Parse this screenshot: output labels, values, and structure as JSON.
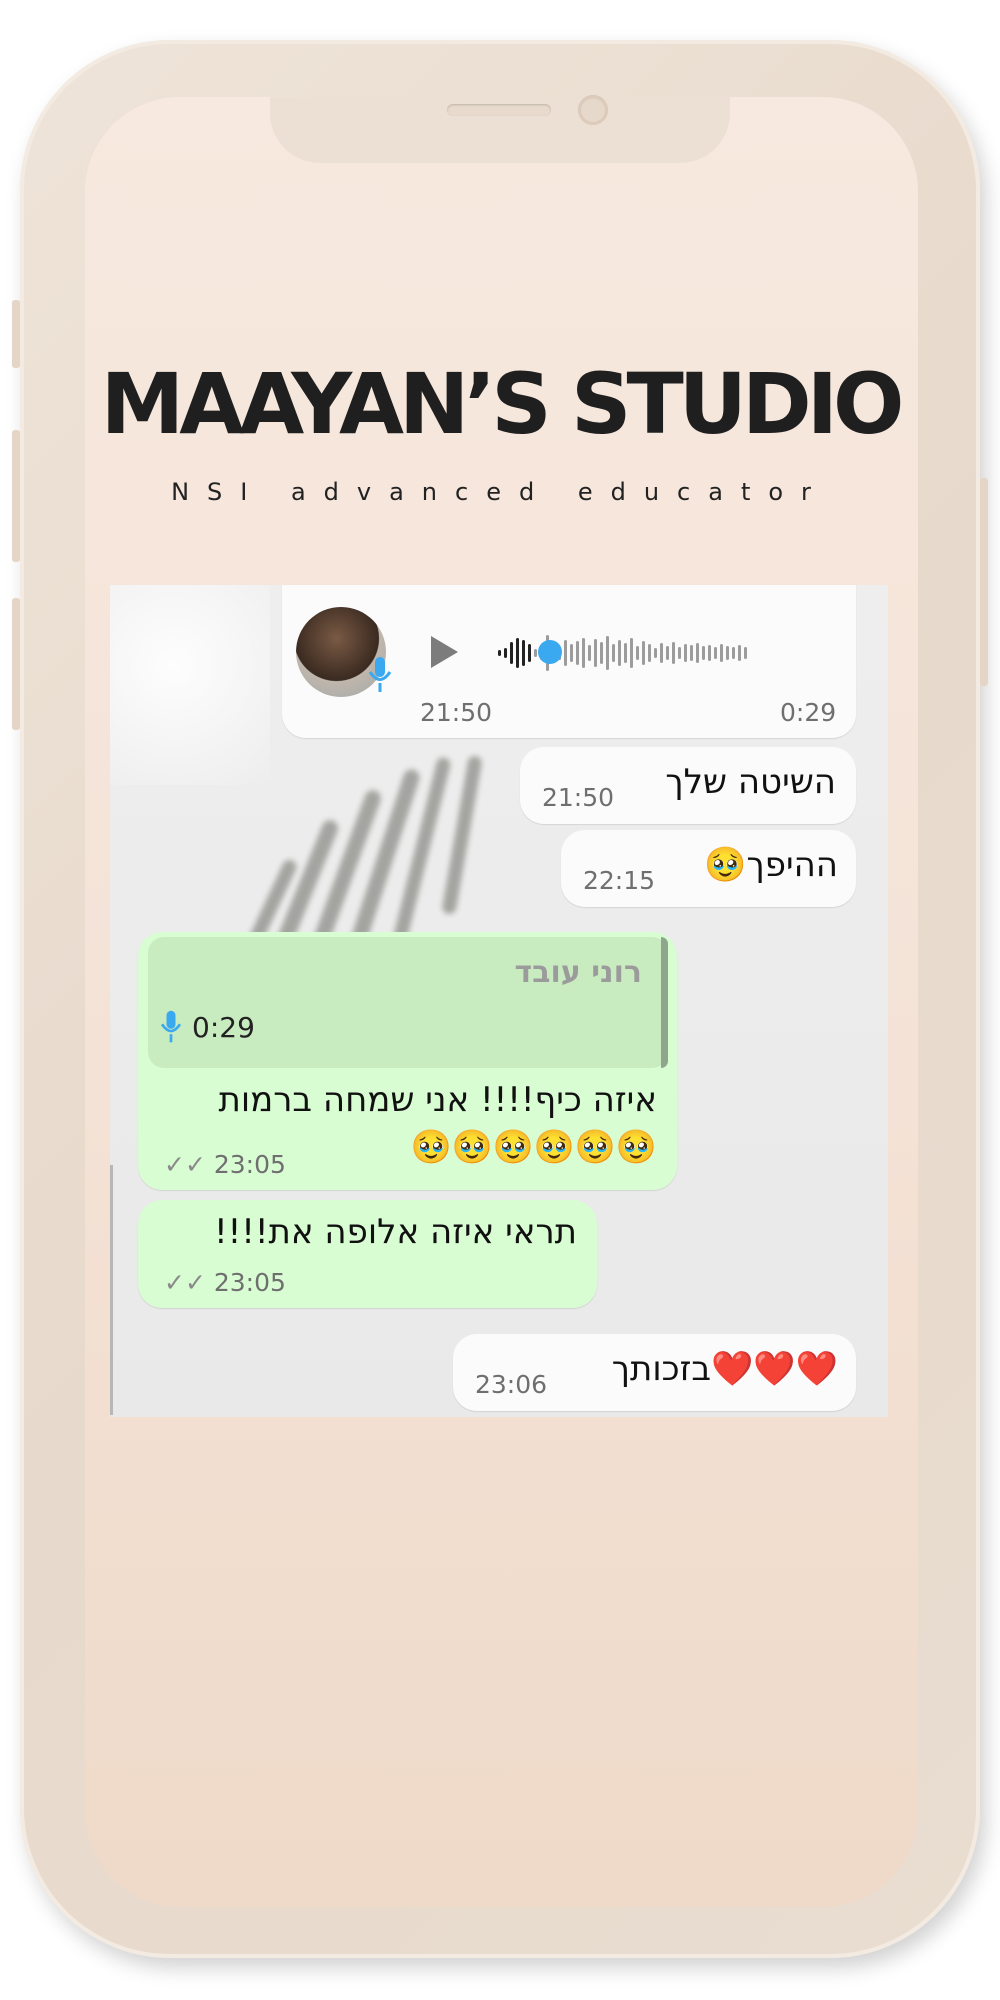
{
  "brand": {
    "title": "MAAYAN’S STUDIO",
    "subtitle": "NSI advanced educator"
  },
  "chat": {
    "voice_message": {
      "time": "21:50",
      "duration": "0:29",
      "progress": 0.05
    },
    "messages": [
      {
        "id": "m1",
        "side": "incoming",
        "text": "השיטה שלך",
        "time": "21:50"
      },
      {
        "id": "m2",
        "side": "incoming",
        "text": "ההיפך🥹",
        "time": "22:15"
      },
      {
        "id": "m3",
        "side": "outgoing",
        "quote_author": "רוני עובד",
        "quote_duration": "0:29",
        "text_line1": "איזה כיף!!!! אני שמחה ברמות",
        "text_line2": "🥹🥹🥹🥹🥹🥹",
        "time": "23:05"
      },
      {
        "id": "m4",
        "side": "outgoing",
        "text": "תראי איזה אלופה את!!!!",
        "time": "23:05"
      },
      {
        "id": "m5",
        "side": "incoming",
        "text": "❤️❤️❤️בזכותך",
        "time": "23:06"
      }
    ]
  },
  "icons": [
    "play-icon",
    "microphone-icon",
    "double-check-icon",
    "avatar"
  ],
  "colors": {
    "outgoing_bubble": "#d9fdd3",
    "incoming_bubble": "#fbfbfb",
    "quote_background": "#c8ecc0",
    "voice_accent": "#3aa9f0",
    "screen_background": "#f5e5d9"
  }
}
